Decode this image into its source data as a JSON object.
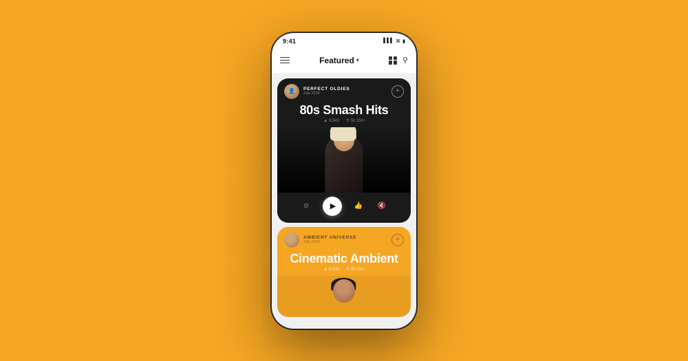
{
  "bg_color": "#F5A623",
  "status_bar": {
    "time": "9:41",
    "signal": "▌▌▌",
    "wifi": "WiFi",
    "battery": "🔋"
  },
  "nav": {
    "title": "Featured",
    "chevron": "▾"
  },
  "card1": {
    "username": "PERFECT OLDIES",
    "date": "July 2018",
    "add_label": "+",
    "title": "80s Smash Hits",
    "meta_followers": "9,543",
    "meta_duration": "5h 35m",
    "followers_icon": "▲",
    "duration_icon": "⏱"
  },
  "card2": {
    "username": "AMBIENT UNIVERSE",
    "date": "July 2018",
    "add_label": "+",
    "title": "Cinematic Ambient",
    "meta_followers": "6,532",
    "meta_duration": "5h 35m",
    "followers_icon": "▲",
    "duration_icon": "⏱"
  }
}
